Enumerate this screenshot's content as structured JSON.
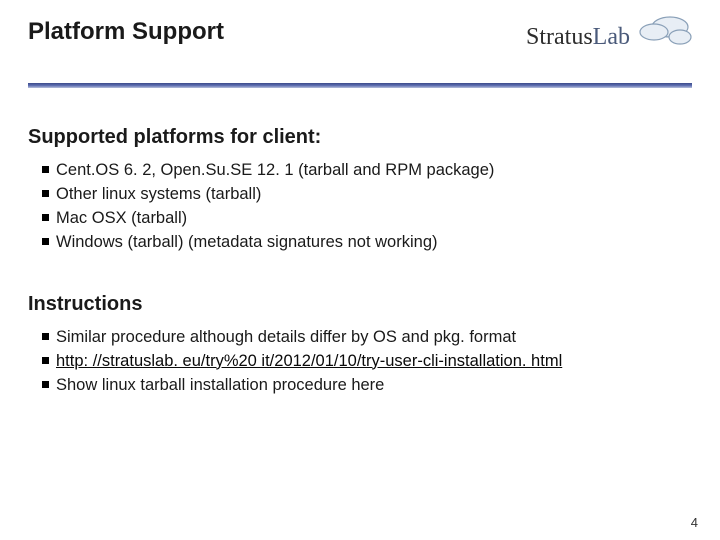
{
  "header": {
    "title": "Platform Support",
    "logo_text": "StratusLab"
  },
  "sections": [
    {
      "heading": "Supported platforms for client:",
      "items": [
        "Cent.OS 6. 2, Open.Su.SE 12. 1 (tarball and RPM package)",
        "Other linux systems (tarball)",
        "Mac OSX (tarball)",
        "Windows (tarball) (metadata signatures not working)"
      ]
    },
    {
      "heading": "Instructions",
      "items": [
        "Similar procedure although details differ by OS and pkg. format",
        "http: //stratuslab. eu/try%20 it/2012/01/10/try-user-cli-installation. html",
        "Show linux tarball installation procedure here"
      ]
    }
  ],
  "page_number": "4"
}
